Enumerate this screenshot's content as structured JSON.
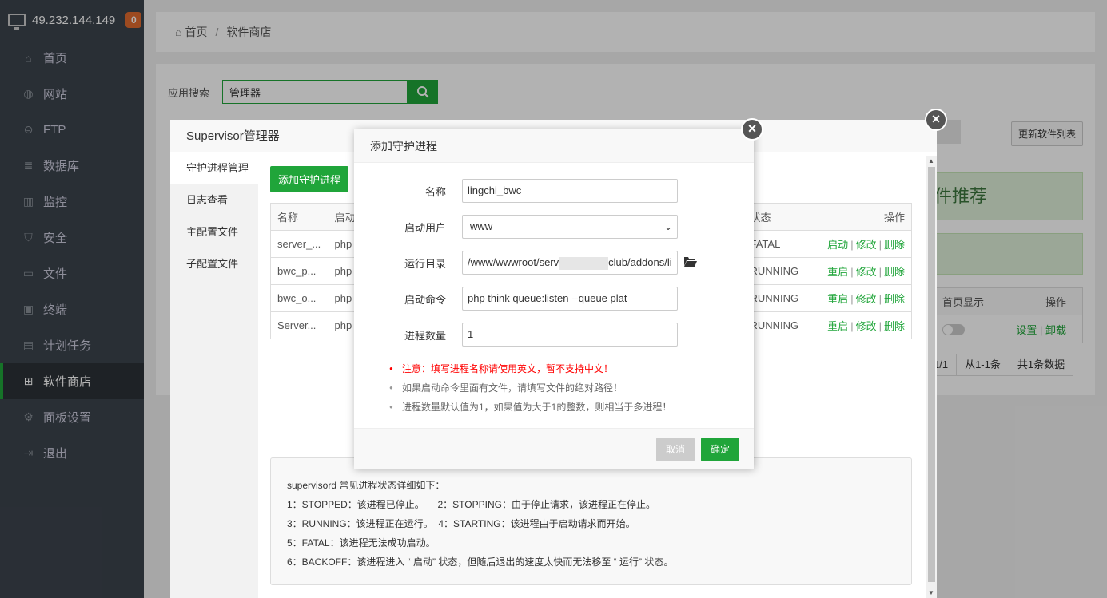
{
  "sidebar": {
    "ip": "49.232.144.149",
    "badge": "0",
    "items": [
      {
        "label": "首页",
        "icon": "home-icon"
      },
      {
        "label": "网站",
        "icon": "globe-icon"
      },
      {
        "label": "FTP",
        "icon": "ftp-icon"
      },
      {
        "label": "数据库",
        "icon": "database-icon"
      },
      {
        "label": "监控",
        "icon": "monitor-icon"
      },
      {
        "label": "安全",
        "icon": "shield-icon"
      },
      {
        "label": "文件",
        "icon": "folder-icon"
      },
      {
        "label": "终端",
        "icon": "terminal-icon"
      },
      {
        "label": "计划任务",
        "icon": "calendar-icon"
      },
      {
        "label": "软件商店",
        "icon": "grid-icon"
      },
      {
        "label": "面板设置",
        "icon": "gear-icon"
      },
      {
        "label": "退出",
        "icon": "logout-icon"
      }
    ]
  },
  "breadcrumb": {
    "home": "首页",
    "sep": "/",
    "current": "软件商店"
  },
  "search": {
    "label": "应用搜索",
    "value": "管理器"
  },
  "update_button": "更新软件列表",
  "recommend_text": "件推荐",
  "right_table": {
    "headers": [
      "首页显示",
      "操作"
    ],
    "ops": [
      "设置",
      "|",
      "卸载"
    ]
  },
  "pager": [
    "1/1",
    "从1-1条",
    "共1条数据"
  ],
  "supervisor": {
    "title": "Supervisor管理器",
    "tabs": [
      "守护进程管理",
      "日志查看",
      "主配置文件",
      "子配置文件"
    ],
    "add_button": "添加守护进程",
    "table": {
      "headers": [
        "名称",
        "启动",
        "状态",
        "操作"
      ],
      "rows": [
        {
          "name": "server_...",
          "cmd": "php",
          "status": "FATAL",
          "ops": [
            "启动",
            "修改",
            "删除"
          ]
        },
        {
          "name": "bwc_p...",
          "cmd": "php",
          "status": "RUNNING",
          "ops": [
            "重启",
            "修改",
            "删除"
          ]
        },
        {
          "name": "bwc_o...",
          "cmd": "php",
          "status": "RUNNING",
          "ops": [
            "重启",
            "修改",
            "删除"
          ]
        },
        {
          "name": "Server...",
          "cmd": "php",
          "status": "RUNNING",
          "ops": [
            "重启",
            "修改",
            "删除"
          ]
        }
      ]
    },
    "notes": [
      "supervisord 常见进程状态详细如下：",
      "1：STOPPED：该进程已停止。     2：STOPPING：由于停止请求，该进程正在停止。",
      "3：RUNNING：该进程正在运行。  4：STARTING：该进程由于启动请求而开始。",
      "5：FATAL：该进程无法成功启动。",
      "6：BACKOFF：该进程进入 “ 启动” 状态，但随后退出的速度太快而无法移至 “ 运行” 状态。"
    ]
  },
  "dialog": {
    "title": "添加守护进程",
    "fields": {
      "name": {
        "label": "名称",
        "value": "lingchi_bwc"
      },
      "user": {
        "label": "启动用户",
        "value": "www"
      },
      "dir": {
        "label": "运行目录",
        "value_start": "/www/wwwroot/serv",
        "value_end": "club/addons/li"
      },
      "cmd": {
        "label": "启动命令",
        "value": "php think queue:listen --queue plat"
      },
      "count": {
        "label": "进程数量",
        "value": "1"
      }
    },
    "tips": [
      "注意：填写进程名称请使用英文，暂不支持中文！",
      "如果启动命令里面有文件，请填写文件的绝对路径！",
      "进程数量默认值为1，如果值为大于1的整数，则相当于多进程！"
    ],
    "cancel": "取消",
    "ok": "确定"
  },
  "close_glyph": "×"
}
